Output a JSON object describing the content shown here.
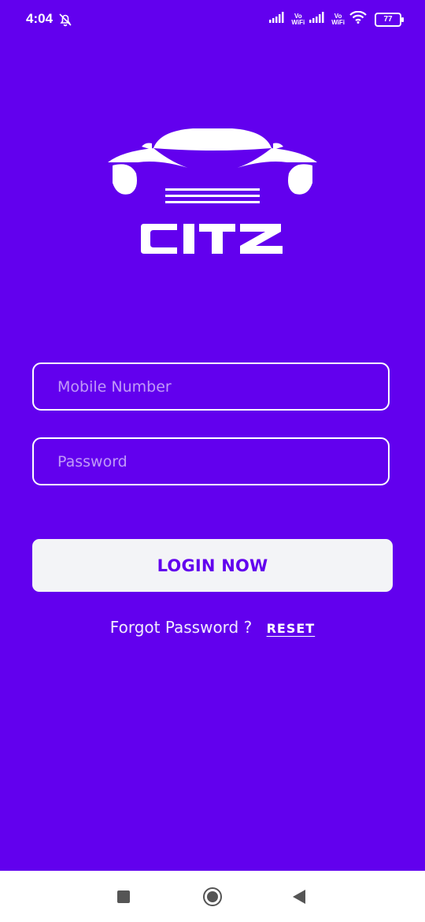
{
  "status_bar": {
    "time": "4:04",
    "vowifi_1": "Vo\nWiFi",
    "vowifi_2": "Vo\nWiFi",
    "battery": "77"
  },
  "app": {
    "brand": "CITZ"
  },
  "form": {
    "mobile_placeholder": "Mobile Number",
    "password_placeholder": "Password",
    "login_label": "LOGIN NOW",
    "forgot_text": "Forgot Password ?",
    "reset_label": "RESET"
  },
  "colors": {
    "background": "#6200EE",
    "button_bg": "#F3F4F7",
    "button_text": "#6200EE"
  },
  "icons": {
    "mute": "bell-off-icon",
    "signal": "signal-icon",
    "wifi": "wifi-icon",
    "battery": "battery-icon",
    "nav_recent": "recent-apps-icon",
    "nav_home": "home-icon",
    "nav_back": "back-icon"
  }
}
